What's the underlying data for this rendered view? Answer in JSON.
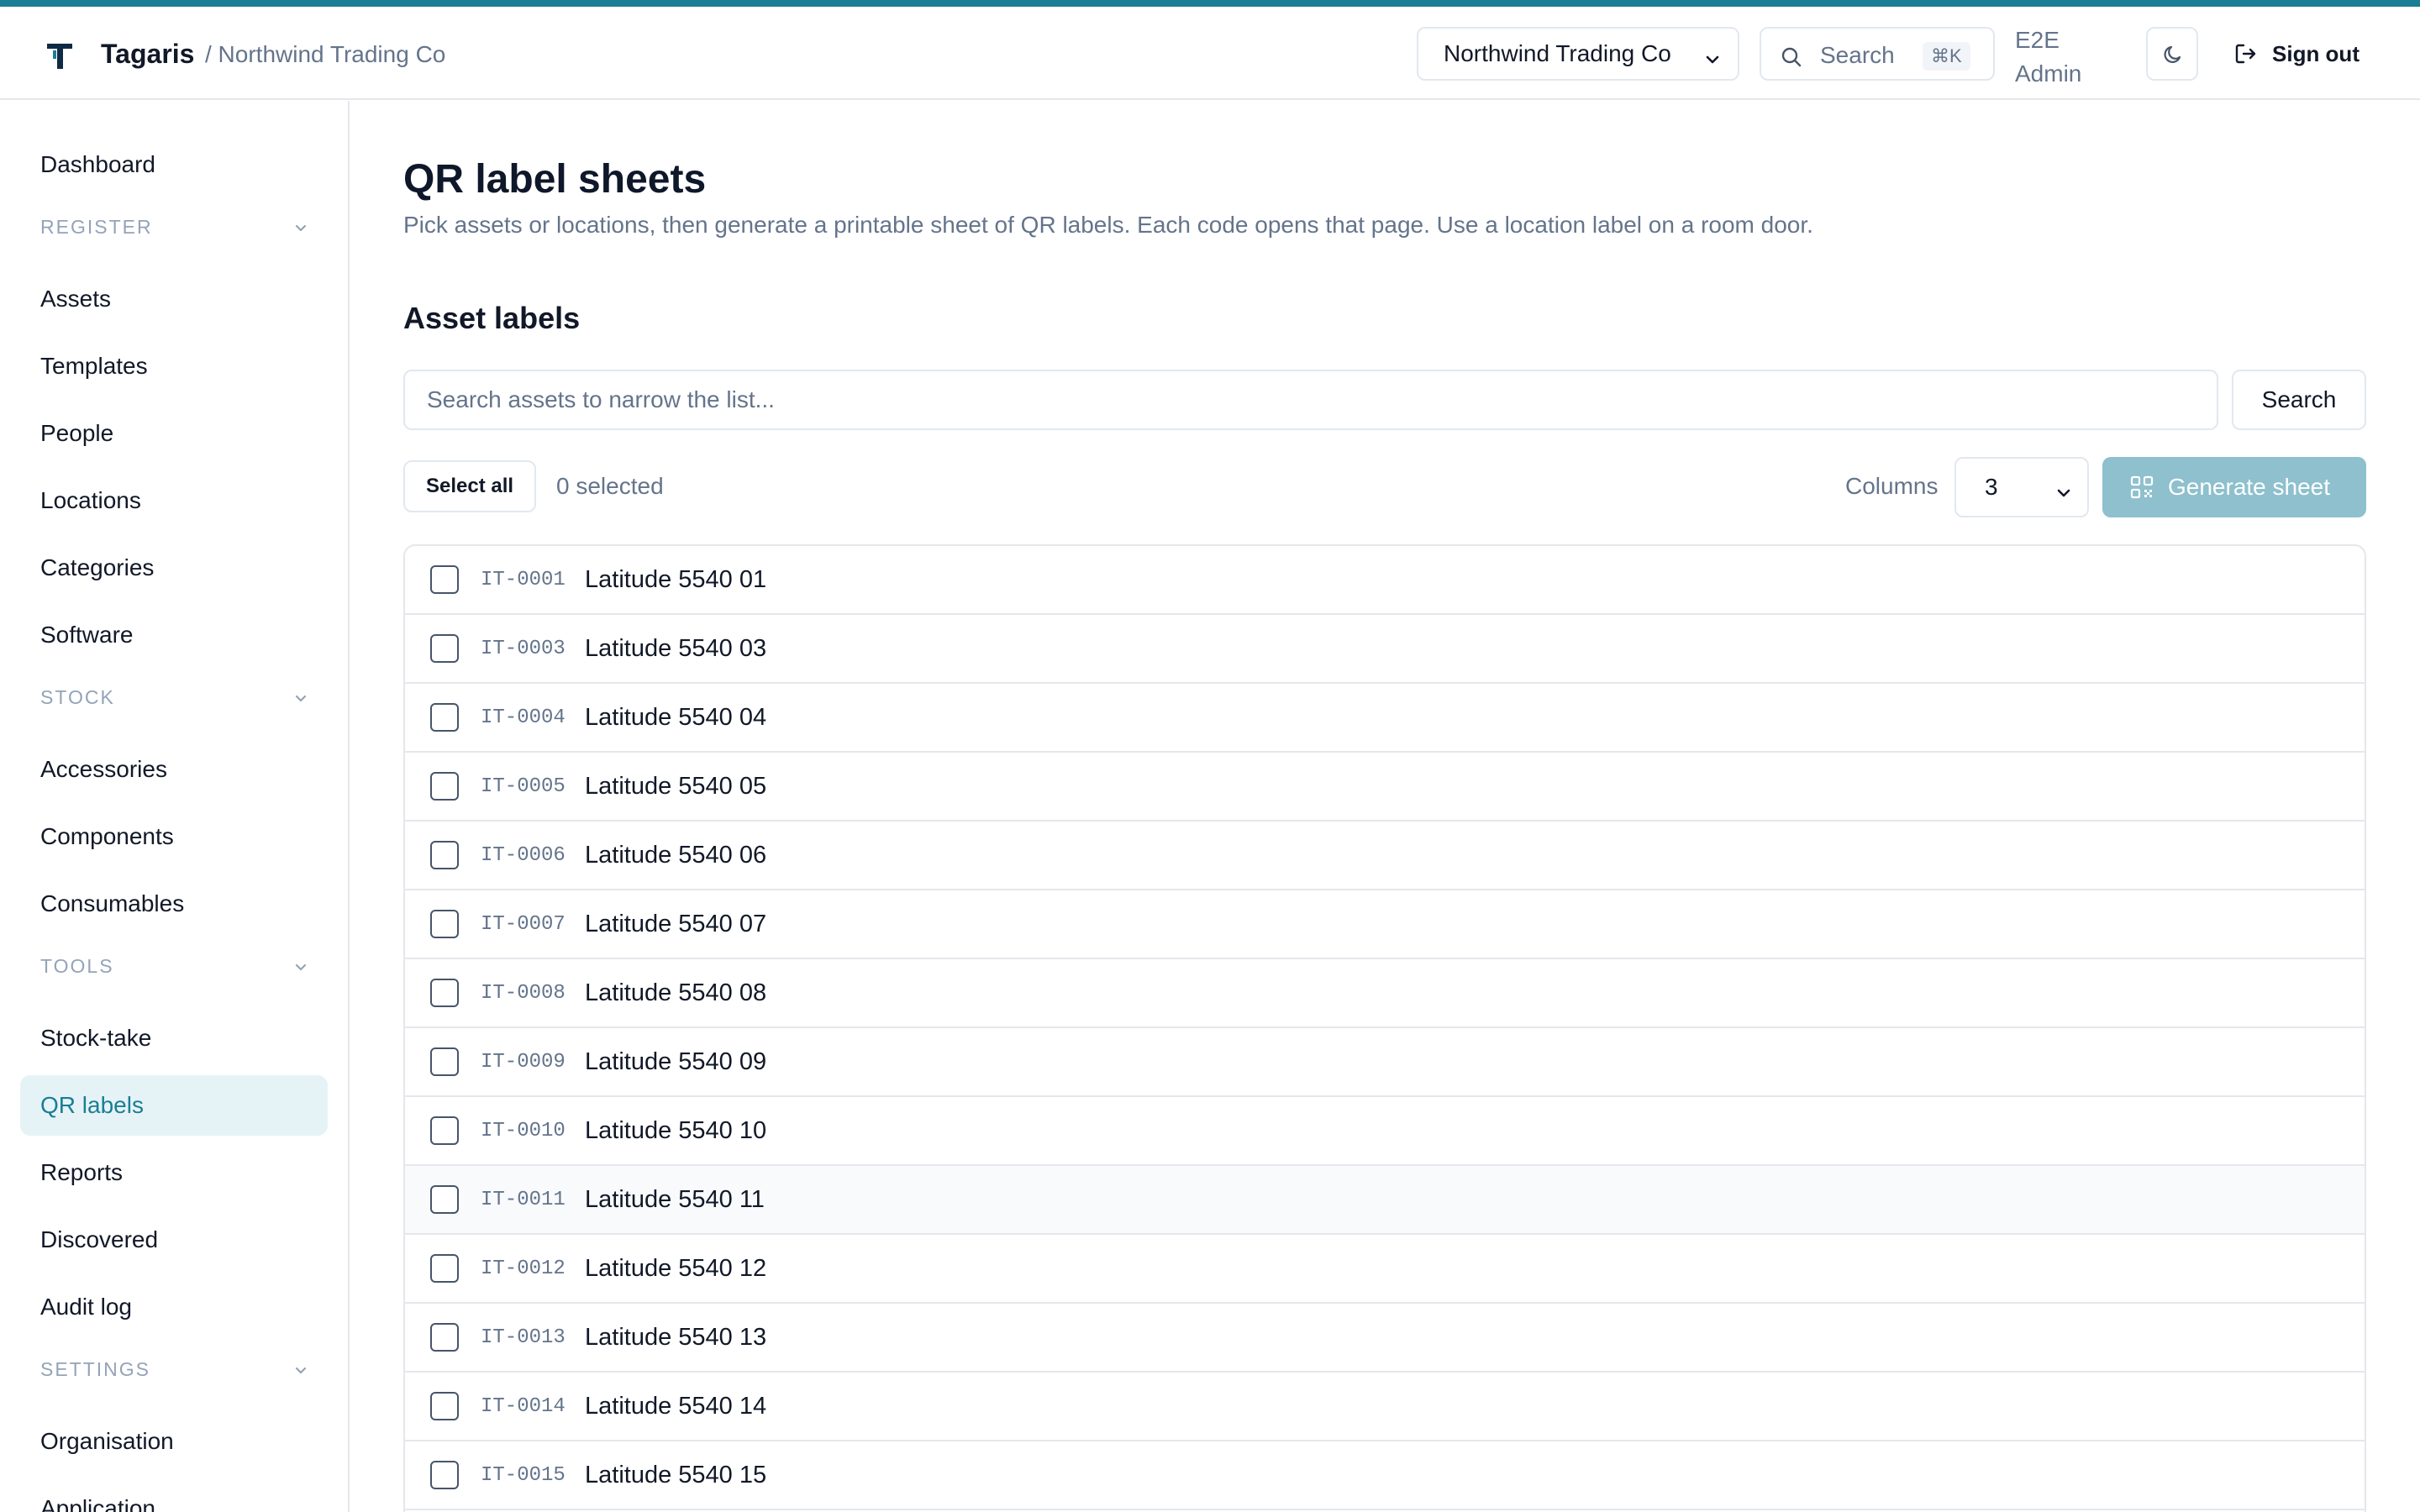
{
  "header": {
    "app_name": "Tagaris",
    "org_breadcrumb": "/ Northwind Trading Co",
    "org_selected": "Northwind Trading Co",
    "search_label": "Search",
    "search_shortcut": "⌘K",
    "user_name": "E2E Admin",
    "sign_out_label": "Sign out"
  },
  "sidebar": {
    "dashboard": "Dashboard",
    "sections": {
      "register": "REGISTER",
      "stock": "STOCK",
      "tools": "TOOLS",
      "settings": "SETTINGS"
    },
    "items": {
      "assets": "Assets",
      "templates": "Templates",
      "people": "People",
      "locations": "Locations",
      "categories": "Categories",
      "software": "Software",
      "accessories": "Accessories",
      "components": "Components",
      "consumables": "Consumables",
      "stocktake": "Stock-take",
      "qr_labels": "QR labels",
      "reports": "Reports",
      "discovered": "Discovered",
      "audit_log": "Audit log",
      "organisation": "Organisation",
      "application": "Application"
    },
    "active_item": "QR labels"
  },
  "main": {
    "title": "QR label sheets",
    "description": "Pick assets or locations, then generate a printable sheet of QR labels. Each code opens that page. Use a location label on a room door.",
    "section_title": "Asset labels",
    "search_placeholder": "Search assets to narrow the list...",
    "search_button": "Search",
    "select_all": "Select all",
    "selected_count": "0 selected",
    "columns_label": "Columns",
    "columns_value": "3",
    "generate_button": "Generate sheet",
    "assets": [
      {
        "code": "IT-0001",
        "name": "Latitude 5540 01"
      },
      {
        "code": "IT-0003",
        "name": "Latitude 5540 03"
      },
      {
        "code": "IT-0004",
        "name": "Latitude 5540 04"
      },
      {
        "code": "IT-0005",
        "name": "Latitude 5540 05"
      },
      {
        "code": "IT-0006",
        "name": "Latitude 5540 06"
      },
      {
        "code": "IT-0007",
        "name": "Latitude 5540 07"
      },
      {
        "code": "IT-0008",
        "name": "Latitude 5540 08"
      },
      {
        "code": "IT-0009",
        "name": "Latitude 5540 09"
      },
      {
        "code": "IT-0010",
        "name": "Latitude 5540 10"
      },
      {
        "code": "IT-0011",
        "name": "Latitude 5540 11"
      },
      {
        "code": "IT-0012",
        "name": "Latitude 5540 12"
      },
      {
        "code": "IT-0013",
        "name": "Latitude 5540 13"
      },
      {
        "code": "IT-0014",
        "name": "Latitude 5540 14"
      },
      {
        "code": "IT-0015",
        "name": "Latitude 5540 15"
      }
    ]
  },
  "colors": {
    "accent": "#1a7e95",
    "active_bg": "#e6f3f6",
    "muted_text": "#64748b",
    "disabled_button": "#8ec0ce"
  },
  "icons": {
    "logo": "tagaris-logo-icon",
    "search": "search-icon",
    "theme": "moon-icon",
    "sign_out": "sign-out-icon",
    "chevron": "chevron-down-icon",
    "qr": "qr-code-icon"
  }
}
